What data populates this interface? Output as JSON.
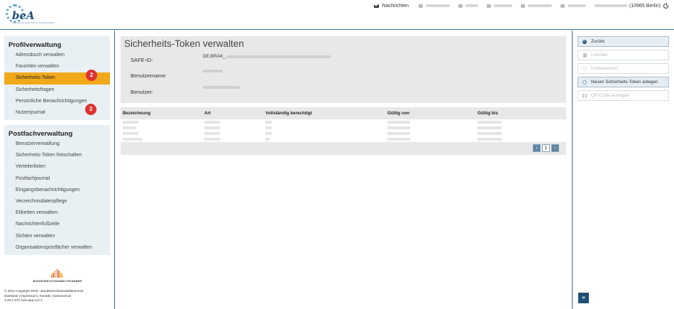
{
  "header": {
    "logo_text": "beA",
    "logo_tagline": "Besonderes elektronisches Anwaltspostfach",
    "nav_messages_label": "Nachrichten",
    "user_label": "(10965 Berlin)"
  },
  "sidebar": {
    "profile_title": "Profilverwaltung",
    "profile_items": [
      "Adressbuch verwalten",
      "Favoriten verwalten",
      "Sicherheits-Token",
      "Sicherheitsfragen",
      "Persönliche Benachrichtigungen",
      "Nutzerjournal"
    ],
    "mailbox_title": "Postfachverwaltung",
    "mailbox_items": [
      "Benutzerverwaltung",
      "Sicherheits-Token freischalten",
      "Verteilerlisten",
      "Postfachjournal",
      "Eingangsbenachrichtigungen",
      "Verzeichnisdatenpflege",
      "Etiketten verwalten",
      "Nachrichtenfußzeile",
      "Sichten verwalten",
      "Organisationspostfächer verwalten"
    ],
    "badges": {
      "profile": "2",
      "token": "3"
    },
    "footer": {
      "brand": "BUNDESRECHTSANWALTSKAMMER",
      "copyright": "© 2024 Copyright 2018 - Bundesrechtsanwaltskammer",
      "links": "Startseite | Impressum | Kontakt | Datenschutz",
      "version": "3.28.2.373, bea-app-cc2-2"
    }
  },
  "main": {
    "title": "Sicherheits-Token verwalten",
    "fields": {
      "safe_id_label": "SAFE-ID:",
      "safe_id_value": "DE.BRAK_",
      "username_label": "Benutzername:",
      "user_label": "Benutzer:"
    },
    "table": {
      "columns": [
        "Bezeichnung",
        "Art",
        "Vollständig berechtigt",
        "Gültig von",
        "Gültig bis"
      ]
    },
    "pager": {
      "prev": "‹",
      "page": "1",
      "next": "›"
    }
  },
  "actions": {
    "back": "Zurück",
    "delete": "Löschen",
    "rename": "Umbenennen",
    "new_token": "Neuen Sicherheits-Token anlegen",
    "qr": "QR-Code erzeugen",
    "expand": "»"
  },
  "colors": {
    "accent_blue": "#214f74",
    "active_item": "#f1a91b",
    "badge_red": "#de3232",
    "section_bg": "#e9f0f4"
  }
}
